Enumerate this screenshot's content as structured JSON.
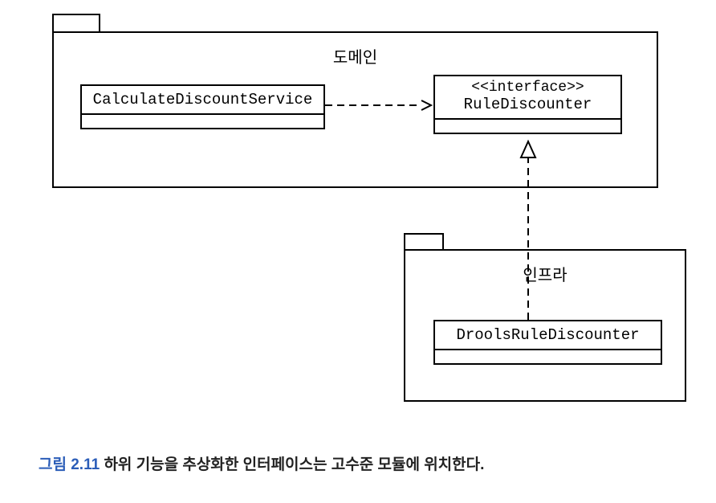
{
  "packages": {
    "domain": {
      "label": "도메인"
    },
    "infra": {
      "label": "인프라"
    }
  },
  "classes": {
    "calc": {
      "name": "CalculateDiscountService"
    },
    "rule": {
      "stereotype": "<<interface>>",
      "name": "RuleDiscounter"
    },
    "drools": {
      "name": "DroolsRuleDiscounter"
    }
  },
  "caption": {
    "num": "그림 2.11",
    "text": " 하위 기능을 추상화한 인터페이스는 고수준 모듈에 위치한다."
  },
  "chart_data": {
    "type": "diagram",
    "uml_type": "package-class",
    "packages": [
      {
        "name": "도메인",
        "contains": [
          "CalculateDiscountService",
          "RuleDiscounter"
        ]
      },
      {
        "name": "인프라",
        "contains": [
          "DroolsRuleDiscounter"
        ]
      }
    ],
    "classes": [
      {
        "name": "CalculateDiscountService",
        "kind": "class"
      },
      {
        "name": "RuleDiscounter",
        "kind": "interface"
      },
      {
        "name": "DroolsRuleDiscounter",
        "kind": "class"
      }
    ],
    "relations": [
      {
        "from": "CalculateDiscountService",
        "to": "RuleDiscounter",
        "type": "dependency"
      },
      {
        "from": "DroolsRuleDiscounter",
        "to": "RuleDiscounter",
        "type": "realization"
      }
    ]
  }
}
